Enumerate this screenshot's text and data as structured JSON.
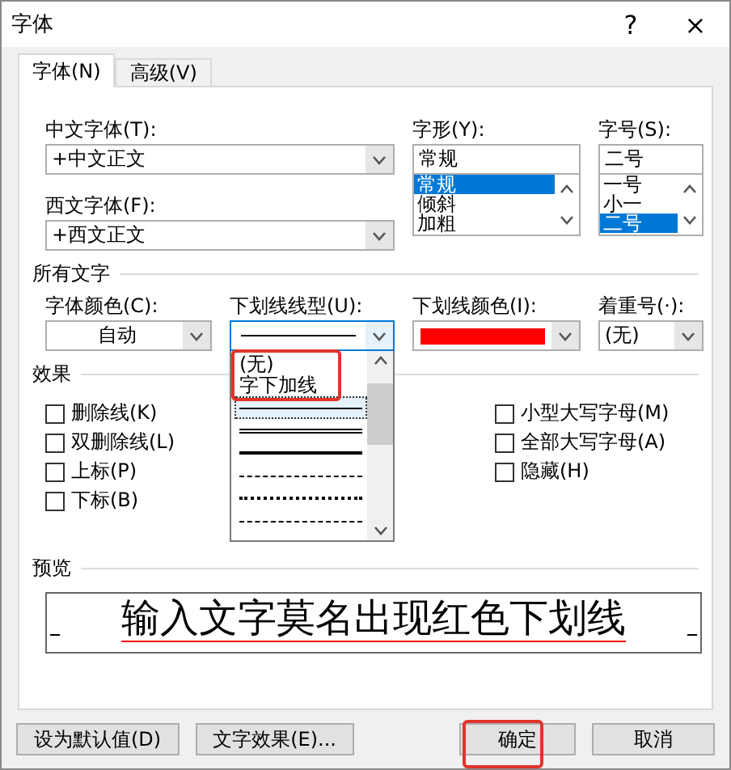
{
  "window": {
    "title": "字体",
    "help": "?",
    "close": "×"
  },
  "tabs": [
    {
      "label": "字体(N)",
      "selected": true
    },
    {
      "label": "高级(V)",
      "selected": false
    }
  ],
  "chinese_font": {
    "label": "中文字体(T):",
    "value": "+中文正文"
  },
  "western_font": {
    "label": "西文字体(F):",
    "value": "+西文正文"
  },
  "style": {
    "label": "字形(Y):",
    "value": "常规",
    "options": [
      {
        "label": "常规",
        "selected": true
      },
      {
        "label": "倾斜",
        "selected": false
      },
      {
        "label": "加粗",
        "selected": false
      }
    ]
  },
  "size": {
    "label": "字号(S):",
    "value": "二号",
    "options": [
      {
        "label": "一号",
        "selected": false
      },
      {
        "label": "小一",
        "selected": false
      },
      {
        "label": "二号",
        "selected": true
      }
    ]
  },
  "all_text": {
    "title": "所有文字",
    "font_color": {
      "label": "字体颜色(C):",
      "value": "自动"
    },
    "underline_style": {
      "label": "下划线线型(U):",
      "expanded": true,
      "annotated": true,
      "items": [
        {
          "kind": "text",
          "label": "(无)",
          "selected": false
        },
        {
          "kind": "text",
          "label": "字下加线",
          "selected": false
        },
        {
          "kind": "line",
          "selected": true
        },
        {
          "kind": "line",
          "selected": false
        },
        {
          "kind": "line",
          "selected": false
        },
        {
          "kind": "line",
          "selected": false
        },
        {
          "kind": "line",
          "selected": false
        },
        {
          "kind": "line",
          "selected": false
        }
      ]
    },
    "underline_color": {
      "label": "下划线颜色(I):",
      "color": "#ff0000"
    },
    "emphasis": {
      "label": "着重号(·):",
      "value": "(无)"
    }
  },
  "effects": {
    "title": "效果",
    "left": [
      {
        "label": "删除线(K)",
        "checked": false
      },
      {
        "label": "双删除线(L)",
        "checked": false
      },
      {
        "label": "上标(P)",
        "checked": false
      },
      {
        "label": "下标(B)",
        "checked": false
      }
    ],
    "right": [
      {
        "label": "小型大写字母(M)",
        "checked": false
      },
      {
        "label": "全部大写字母(A)",
        "checked": false
      },
      {
        "label": "隐藏(H)",
        "checked": false
      }
    ]
  },
  "preview": {
    "title": "预览",
    "text": "输入文字莫名出现红色下划线"
  },
  "buttons": [
    {
      "label": "设为默认值(D)",
      "kind": "left",
      "annotated": false
    },
    {
      "label": "文字效果(E)...",
      "kind": "left",
      "annotated": false
    },
    {
      "label": "确定",
      "kind": "right",
      "annotated": true
    },
    {
      "label": "取消",
      "kind": "right",
      "annotated": false
    }
  ]
}
